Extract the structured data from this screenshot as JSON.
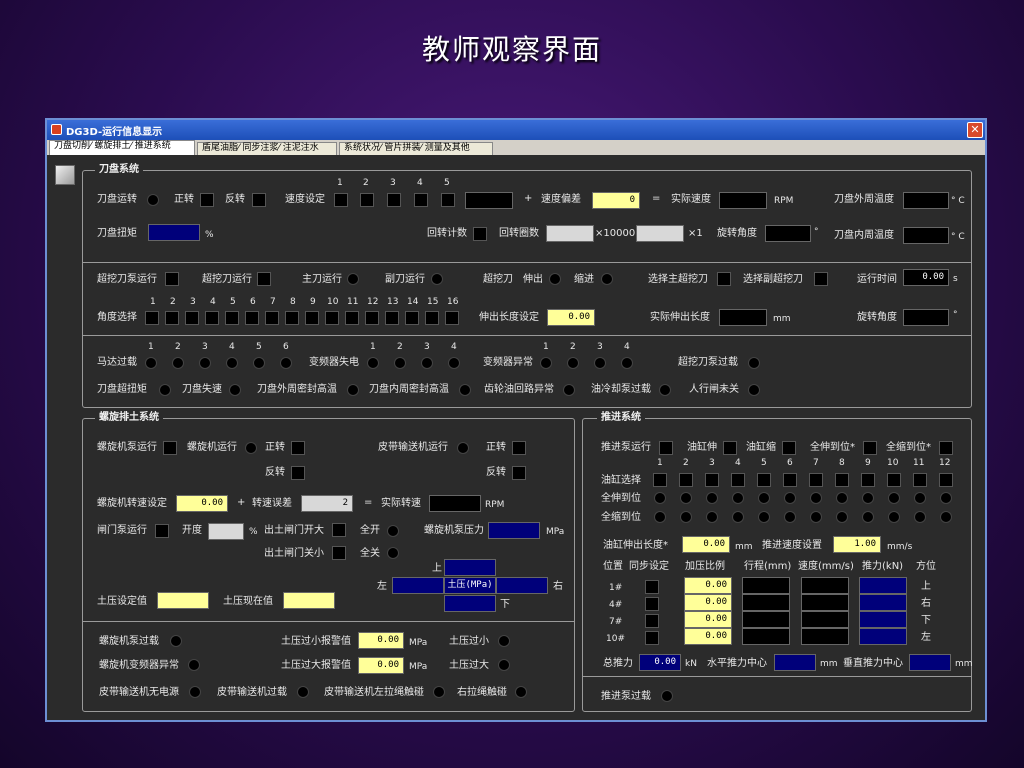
{
  "slide_title": "教师观察界面",
  "window": {
    "title": "DG3D-运行信息显示",
    "close": "✕"
  },
  "tabs": [
    {
      "label": "刀盘切削⁄ 螺旋排土⁄ 推进系统",
      "active": true
    },
    {
      "label": "盾尾油脂⁄ 同步注浆⁄ 注泥注水",
      "active": false
    },
    {
      "label": "系统状况⁄ 管片拼装⁄ 测量及其他",
      "active": false
    }
  ],
  "cutter": {
    "title": "刀盘系统",
    "run": "刀盘运转",
    "fwd": "正转",
    "rev": "反转",
    "speed_set": "速度设定",
    "speed_nums": [
      "1",
      "2",
      "3",
      "4",
      "5"
    ],
    "plus": "+",
    "deviation": "速度偏差",
    "deviation_val": "0",
    "eq": "=",
    "actual_speed": "实际速度",
    "rpm": "RPM",
    "outer_temp": "刀盘外周温度",
    "inner_temp": "刀盘内周温度",
    "degc": "° C",
    "torque": "刀盘扭矩",
    "pct": "%",
    "rot_count": "回转计数",
    "rot_turns": "回转圈数",
    "x10000": "×10000",
    "x1": "×1",
    "rot_angle": "旋转角度",
    "deg": "°",
    "over_pump": "超挖刀泵运行",
    "over_run": "超挖刀运行",
    "main_run": "主刀运行",
    "sub_run": "副刀运行",
    "over_cutter": "超挖刀",
    "extend": "伸出",
    "retract": "缩进",
    "sel_main": "选择主超挖刀",
    "sel_sub": "选择副超挖刀",
    "run_time": "运行时间",
    "run_time_val": "0.00",
    "sec": "s",
    "angle_sel": "角度选择",
    "angle_nums": [
      "1",
      "2",
      "3",
      "4",
      "5",
      "6",
      "7",
      "8",
      "9",
      "10",
      "11",
      "12",
      "13",
      "14",
      "15",
      "16"
    ],
    "ext_set": "伸出长度设定",
    "ext_set_val": "0.00",
    "ext_actual": "实际伸出长度",
    "mm": "mm",
    "rot_angle2": "旋转角度",
    "motor_over": "马达过载",
    "motor_nums": [
      "1",
      "2",
      "3",
      "4",
      "5",
      "6"
    ],
    "inv_loss": "变频器失电",
    "inv_nums": [
      "1",
      "2",
      "3",
      "4"
    ],
    "inv_fault": "变频器异常",
    "fault_nums": [
      "1",
      "2",
      "3",
      "4"
    ],
    "over_pump_load": "超挖刀泵过载",
    "over_torque": "刀盘超扭矩",
    "speed_loss": "刀盘失速",
    "outer_seal": "刀盘外周密封高温",
    "inner_seal": "刀盘内周密封高温",
    "gear_oil": "齿轮油回路异常",
    "oil_cool": "油冷却泵过载",
    "door": "人行闸未关"
  },
  "screw": {
    "title": "螺旋排土系统",
    "pump_run": "螺旋机泵运行",
    "run": "螺旋机运行",
    "fwd": "正转",
    "rev": "反转",
    "belt_run": "皮带输送机运行",
    "belt_fwd": "正转",
    "belt_rev": "反转",
    "speed_set": "螺旋机转速设定",
    "speed_val": "0.00",
    "plus": "+",
    "err": "转速误差",
    "err_val": "2",
    "eq": "=",
    "actual": "实际转速",
    "rpm": "RPM",
    "gate_pump": "闸门泵运行",
    "open": "开度",
    "pct": "%",
    "gate_open": "出土闸门开大",
    "full_open": "全开",
    "gate_close": "出土闸门关小",
    "full_close": "全关",
    "pump_press": "螺旋机泵压力",
    "mpa": "MPa",
    "up": "上",
    "left": "左",
    "soil_mpa": "土压(MPa)",
    "right": "右",
    "down": "下",
    "soil_set": "土压设定值",
    "soil_now": "土压现在值",
    "pump_over": "螺旋机泵过载",
    "inv_fault": "螺旋机变频器异常",
    "low_alarm": "土压过小报警值",
    "low_val": "0.00",
    "low": "土压过小",
    "high_alarm": "土压过大报警值",
    "high_val": "0.00",
    "high": "土压过大",
    "belt_nopower": "皮带输送机无电源",
    "belt_over": "皮带输送机过载",
    "belt_left": "皮带输送机左拉绳触碰",
    "belt_right": "右拉绳触碰"
  },
  "thrust": {
    "title": "推进系统",
    "pump_run": "推进泵运行",
    "cyl_ext": "油缸伸",
    "cyl_ret": "油缸缩",
    "all_ext": "全伸到位*",
    "all_ret": "全缩到位*",
    "cyl_nums": [
      "1",
      "2",
      "3",
      "4",
      "5",
      "6",
      "7",
      "8",
      "9",
      "10",
      "11",
      "12"
    ],
    "cyl_sel": "油缸选择",
    "all_ext_pos": "全伸到位",
    "all_ret_pos": "全缩到位",
    "ext_len": "油缸伸出长度*",
    "ext_len_val": "0.00",
    "mm": "mm",
    "speed_set": "推进速度设置",
    "speed_val": "1.00",
    "mms": "mm/s",
    "headers": [
      "位置",
      "同步设定",
      "加压比例",
      "行程(mm)",
      "速度(mm/s)",
      "推力(kN)",
      "方位"
    ],
    "rows": [
      {
        "pos": "1#",
        "ratio": "0.00",
        "dir": "上"
      },
      {
        "pos": "4#",
        "ratio": "0.00",
        "dir": "右"
      },
      {
        "pos": "7#",
        "ratio": "0.00",
        "dir": "下"
      },
      {
        "pos": "10#",
        "ratio": "0.00",
        "dir": "左"
      }
    ],
    "total": "总推力",
    "total_val": "0.00",
    "kn": "kN",
    "h_center": "水平推力中心",
    "v_center": "垂直推力中心",
    "pump_over": "推进泵过载"
  }
}
